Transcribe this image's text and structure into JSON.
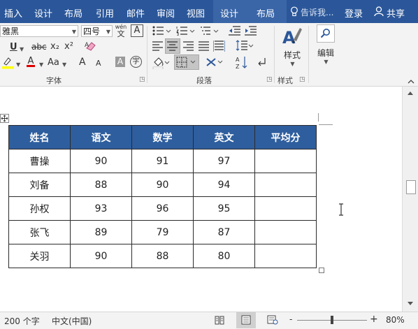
{
  "ribbon_tabs": [
    "插入",
    "设计",
    "布局",
    "引用",
    "邮件",
    "审阅",
    "视图"
  ],
  "context_tabs": [
    "设计",
    "布局"
  ],
  "tell_me": "告诉我...",
  "login": "登录",
  "share": "共享",
  "font": {
    "name": "雅黑",
    "size": "四号",
    "phonetic_top": "wén",
    "phonetic_bottom": "文",
    "boxed_a": "A",
    "underline": "U",
    "strike": "abc",
    "subscript": "x₂",
    "superscript": "x²",
    "color_a": "A",
    "case": "Aa",
    "grow": "A",
    "shrink": "A",
    "shade_a": "A",
    "enclose": "字",
    "group_label": "字体"
  },
  "paragraph": {
    "group_label": "段落"
  },
  "styles": {
    "button_label": "样式",
    "group_label": "样式"
  },
  "editing": {
    "button_label": "编辑"
  },
  "table": {
    "headers": [
      "姓名",
      "语文",
      "数学",
      "英文",
      "平均分"
    ],
    "rows": [
      [
        "曹操",
        "90",
        "91",
        "97",
        ""
      ],
      [
        "刘备",
        "88",
        "90",
        "94",
        ""
      ],
      [
        "孙权",
        "93",
        "96",
        "95",
        ""
      ],
      [
        "张飞",
        "89",
        "79",
        "87",
        ""
      ],
      [
        "关羽",
        "90",
        "88",
        "80",
        ""
      ]
    ]
  },
  "status": {
    "word_count": "200 个字",
    "language": "中文(中国)",
    "zoom_minus": "-",
    "zoom_plus": "+",
    "zoom": "80%",
    "zoom_fraction": 0.5
  },
  "colors": {
    "title_bar": "#2b579a",
    "table_header": "#2e5e9e",
    "highlight_yellow": "#ffff00",
    "font_red": "#e00000"
  }
}
